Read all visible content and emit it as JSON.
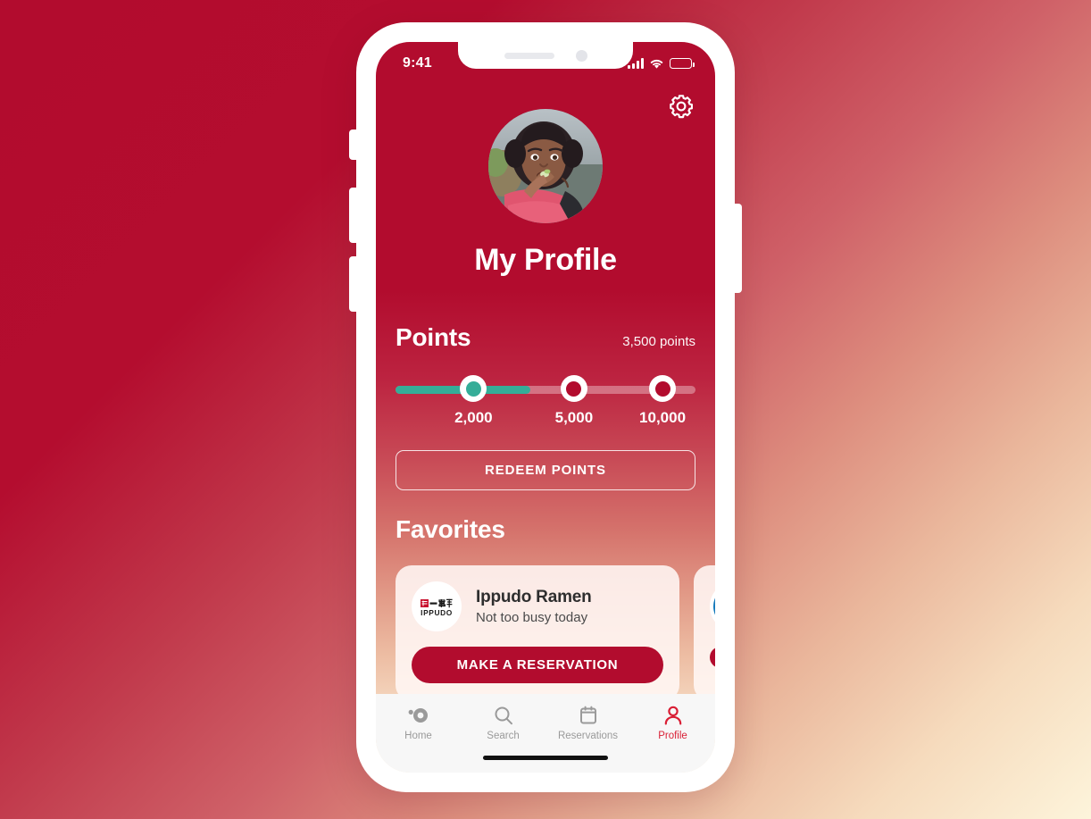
{
  "status_bar": {
    "time": "9:41",
    "signal_icon": "signal-bars-icon",
    "wifi_icon": "wifi-icon",
    "battery_icon": "battery-full-icon"
  },
  "header": {
    "settings_icon": "gear-icon",
    "avatar_alt": "profile-photo",
    "title": "My Profile"
  },
  "points": {
    "heading": "Points",
    "balance": "3,500 points",
    "balance_value": 3500,
    "progress_percent": 45,
    "fill_color": "#35ad98",
    "track_color": "rgba(255,255,255,0.34)",
    "tiers": [
      {
        "label": "2,000",
        "value": 2000,
        "reached": true,
        "dot_color": "#35ad98"
      },
      {
        "label": "5,000",
        "value": 5000,
        "reached": false,
        "dot_color": "#b20c2e"
      },
      {
        "label": "10,000",
        "value": 10000,
        "reached": false,
        "dot_color": "#b20c2e"
      }
    ],
    "redeem_label": "REDEEM POINTS"
  },
  "favorites": {
    "heading": "Favorites",
    "cards": [
      {
        "name": "Ippudo Ramen",
        "status": "Not too busy today",
        "cta_label": "MAKE A RESERVATION",
        "logo": "ippudo-logo",
        "logo_text": "IPPUDO"
      },
      {
        "name": "",
        "status": "",
        "cta_label": "",
        "logo": "blue-circle-logo",
        "logo_text": ""
      }
    ]
  },
  "bottom_nav": {
    "items": [
      {
        "label": "Home",
        "icon": "home-dot-icon",
        "active": false
      },
      {
        "label": "Search",
        "icon": "search-icon",
        "active": false
      },
      {
        "label": "Reservations",
        "icon": "calendar-icon",
        "active": false
      },
      {
        "label": "Profile",
        "icon": "person-icon",
        "active": true
      }
    ]
  },
  "theme": {
    "brand_red": "#b20c2e",
    "accent_teal": "#35ad98",
    "active_nav": "#d91f35",
    "card_bg": "#fdf3f1",
    "bg_start": "#b20c2e",
    "bg_end": "#fdf4db"
  }
}
